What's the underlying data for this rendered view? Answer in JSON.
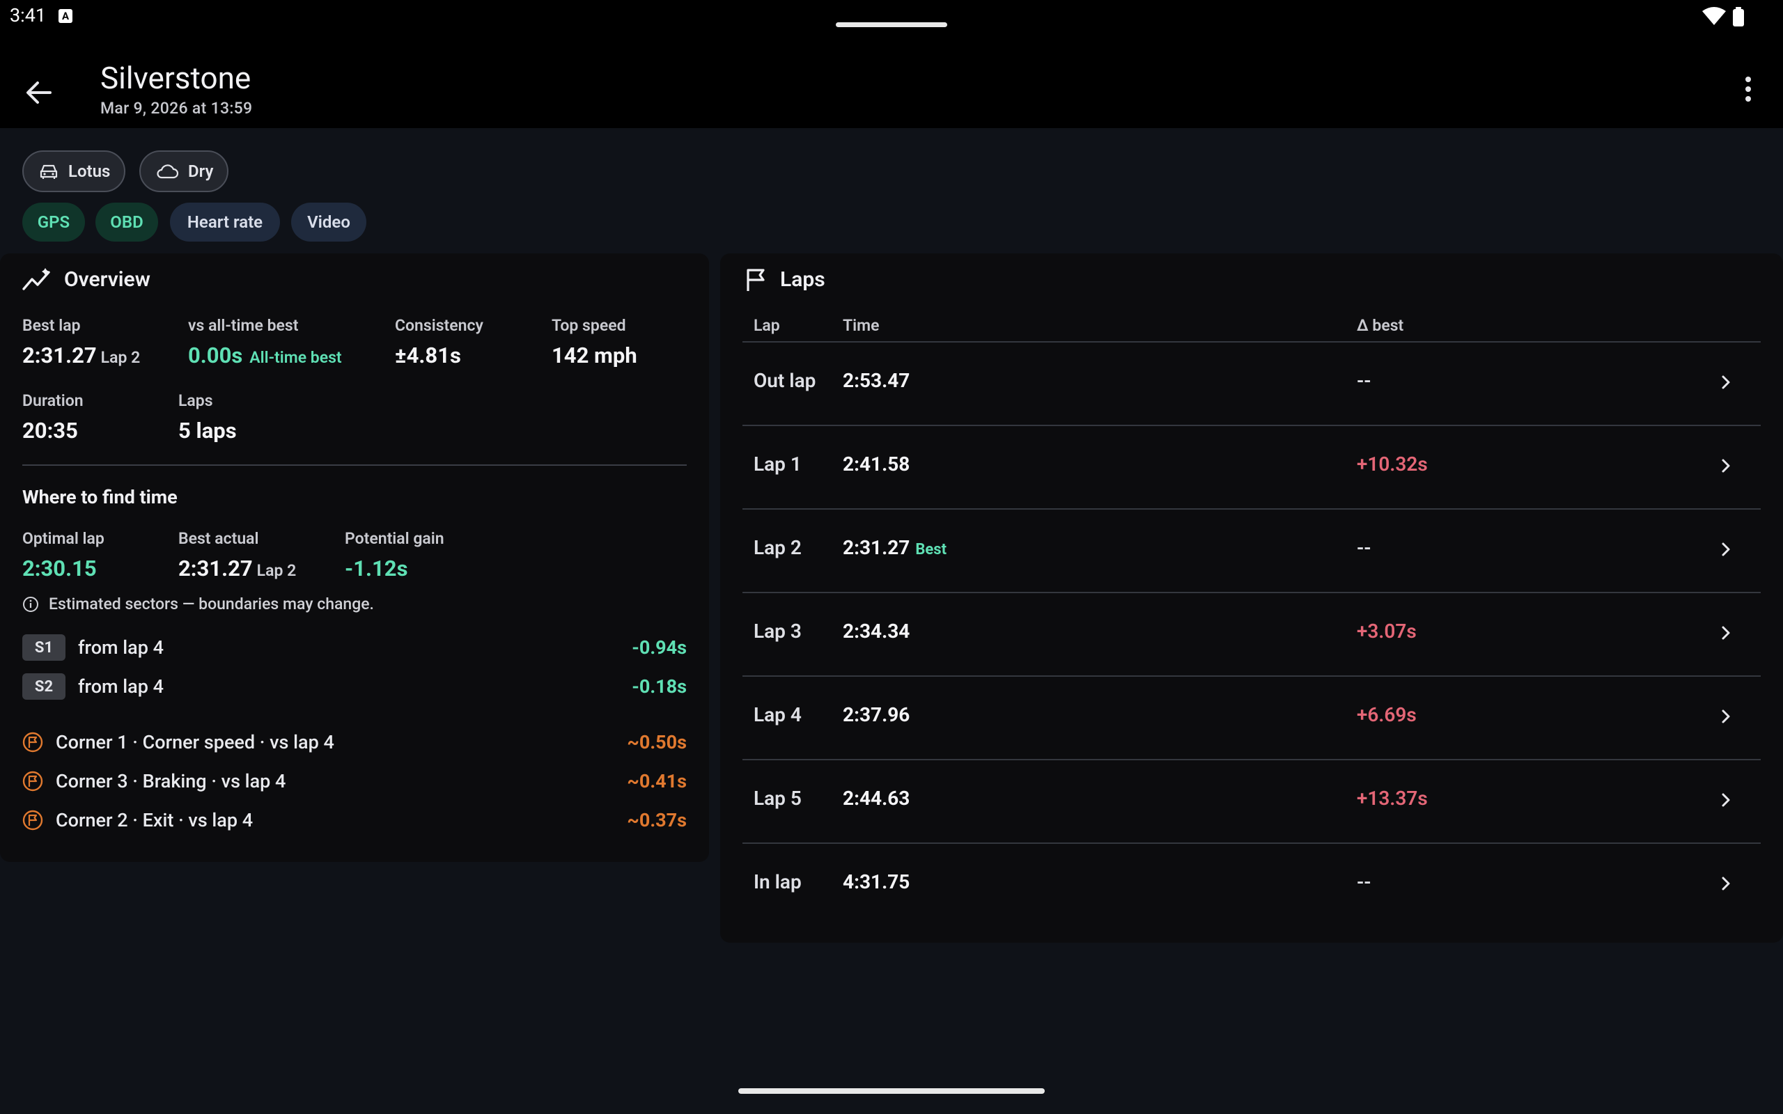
{
  "status": {
    "time": "3:41",
    "notif": "A"
  },
  "header": {
    "title": "Silverstone",
    "subtitle": "Mar 9, 2026 at 13:59"
  },
  "chips": [
    {
      "label": "Lotus",
      "icon": "car-icon"
    },
    {
      "label": "Dry",
      "icon": "cloud-icon"
    }
  ],
  "tags": [
    {
      "label": "GPS",
      "style": "green"
    },
    {
      "label": "OBD",
      "style": "green"
    },
    {
      "label": "Heart rate",
      "style": "blue"
    },
    {
      "label": "Video",
      "style": "blue"
    }
  ],
  "overview": {
    "title": "Overview",
    "best_lap": {
      "label": "Best lap",
      "value": "2:31.27",
      "sub": "Lap 2"
    },
    "vs_alltime": {
      "label": "vs all-time best",
      "value": "0.00s",
      "sub": "All-time best"
    },
    "consistency": {
      "label": "Consistency",
      "value": "±4.81s"
    },
    "top_speed": {
      "label": "Top speed",
      "value": "142 mph"
    },
    "duration": {
      "label": "Duration",
      "value": "20:35"
    },
    "laps": {
      "label": "Laps",
      "value": "5 laps"
    },
    "find_time": {
      "title": "Where to find time",
      "optimal": {
        "label": "Optimal lap",
        "value": "2:30.15"
      },
      "best_actual": {
        "label": "Best actual",
        "value": "2:31.27",
        "sub": "Lap 2"
      },
      "potential": {
        "label": "Potential gain",
        "value": "-1.12s"
      },
      "note": "Estimated sectors — boundaries may change.",
      "sectors": [
        {
          "badge": "S1",
          "text": "from lap 4",
          "gain": "-0.94s"
        },
        {
          "badge": "S2",
          "text": "from lap 4",
          "gain": "-0.18s"
        }
      ],
      "corners": [
        {
          "text": "Corner 1 · Corner speed · vs lap 4",
          "gain": "~0.50s"
        },
        {
          "text": "Corner 3 · Braking · vs lap 4",
          "gain": "~0.41s"
        },
        {
          "text": "Corner 2 · Exit · vs lap 4",
          "gain": "~0.37s"
        }
      ]
    }
  },
  "laps": {
    "title": "Laps",
    "columns": [
      "Lap",
      "Time",
      "Δ best"
    ],
    "rows": [
      {
        "lap": "Out lap",
        "time": "2:53.47",
        "best": "",
        "delta": "--",
        "delta_type": "none"
      },
      {
        "lap": "Lap 1",
        "time": "2:41.58",
        "best": "",
        "delta": "+10.32s",
        "delta_type": "neg"
      },
      {
        "lap": "Lap 2",
        "time": "2:31.27",
        "best": "Best",
        "delta": "--",
        "delta_type": "none"
      },
      {
        "lap": "Lap 3",
        "time": "2:34.34",
        "best": "",
        "delta": "+3.07s",
        "delta_type": "neg"
      },
      {
        "lap": "Lap 4",
        "time": "2:37.96",
        "best": "",
        "delta": "+6.69s",
        "delta_type": "neg"
      },
      {
        "lap": "Lap 5",
        "time": "2:44.63",
        "best": "",
        "delta": "+13.37s",
        "delta_type": "neg"
      },
      {
        "lap": "In lap",
        "time": "4:31.75",
        "best": "",
        "delta": "--",
        "delta_type": "none"
      }
    ]
  },
  "colors": {
    "accent_green": "#5fe0b4",
    "delta_red": "#e46676",
    "corner_orange": "#e0792f",
    "background": "#0f1218"
  }
}
